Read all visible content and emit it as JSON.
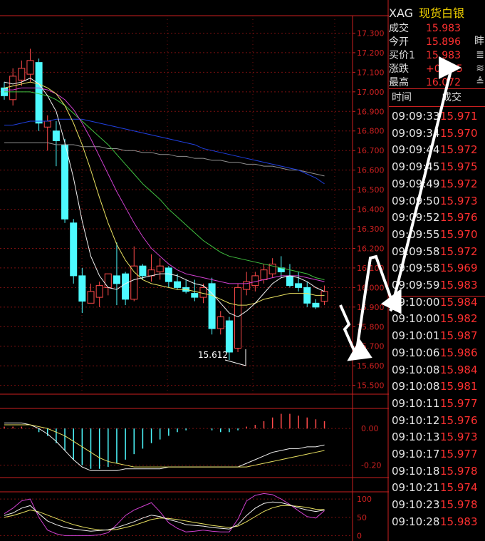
{
  "chart_data": {
    "type": "candlestick",
    "price_axis_ticks": [
      "17.300",
      "17.200",
      "17.100",
      "17.000",
      "16.900",
      "16.800",
      "16.700",
      "16.600",
      "16.500",
      "16.400",
      "16.300",
      "16.200",
      "16.100",
      "16.000",
      "15.900",
      "15.800",
      "15.700",
      "15.600",
      "15.500"
    ],
    "ylim": [
      15.455,
      17.36
    ],
    "low_annotation": "15.612",
    "candles": [
      {
        "o": 17.02,
        "h": 17.05,
        "l": 16.96,
        "c": 16.98
      },
      {
        "o": 16.96,
        "h": 17.12,
        "l": 16.93,
        "c": 17.08
      },
      {
        "o": 17.06,
        "h": 17.16,
        "l": 17.03,
        "c": 17.12
      },
      {
        "o": 17.09,
        "h": 17.22,
        "l": 17.05,
        "c": 17.16
      },
      {
        "o": 17.15,
        "h": 17.17,
        "l": 16.8,
        "c": 16.84
      },
      {
        "o": 16.82,
        "h": 16.88,
        "l": 16.7,
        "c": 16.85
      },
      {
        "o": 16.8,
        "h": 16.85,
        "l": 16.62,
        "c": 16.75
      },
      {
        "o": 16.73,
        "h": 16.76,
        "l": 16.33,
        "c": 16.35
      },
      {
        "o": 16.33,
        "h": 16.35,
        "l": 16.02,
        "c": 16.06
      },
      {
        "o": 16.06,
        "h": 16.1,
        "l": 15.87,
        "c": 15.93
      },
      {
        "o": 15.92,
        "h": 16.02,
        "l": 15.92,
        "c": 15.98
      },
      {
        "o": 15.95,
        "h": 16.03,
        "l": 15.9,
        "c": 16.01
      },
      {
        "o": 16.0,
        "h": 16.07,
        "l": 15.96,
        "c": 16.07
      },
      {
        "o": 16.06,
        "h": 16.23,
        "l": 15.91,
        "c": 16.02
      },
      {
        "o": 16.07,
        "h": 16.08,
        "l": 15.91,
        "c": 15.94
      },
      {
        "o": 15.94,
        "h": 16.21,
        "l": 15.93,
        "c": 16.11
      },
      {
        "o": 16.11,
        "h": 16.12,
        "l": 16.04,
        "c": 16.06
      },
      {
        "o": 16.06,
        "h": 16.17,
        "l": 16.03,
        "c": 16.09
      },
      {
        "o": 16.08,
        "h": 16.15,
        "l": 16.04,
        "c": 16.11
      },
      {
        "o": 16.1,
        "h": 16.11,
        "l": 16.0,
        "c": 16.03
      },
      {
        "o": 16.03,
        "h": 16.07,
        "l": 15.99,
        "c": 16.0
      },
      {
        "o": 16.0,
        "h": 16.04,
        "l": 15.97,
        "c": 15.98
      },
      {
        "o": 15.97,
        "h": 16.04,
        "l": 15.93,
        "c": 15.95
      },
      {
        "o": 15.95,
        "h": 16.02,
        "l": 15.92,
        "c": 16.0
      },
      {
        "o": 16.02,
        "h": 16.05,
        "l": 15.76,
        "c": 15.79
      },
      {
        "o": 15.79,
        "h": 15.88,
        "l": 15.76,
        "c": 15.85
      },
      {
        "o": 15.83,
        "h": 15.85,
        "l": 15.63,
        "c": 15.67
      },
      {
        "o": 15.69,
        "h": 16.02,
        "l": 15.67,
        "c": 16.0
      },
      {
        "o": 15.99,
        "h": 16.08,
        "l": 15.96,
        "c": 16.03
      },
      {
        "o": 16.01,
        "h": 16.08,
        "l": 15.98,
        "c": 16.06
      },
      {
        "o": 16.04,
        "h": 16.12,
        "l": 16.02,
        "c": 16.09
      },
      {
        "o": 16.07,
        "h": 16.15,
        "l": 16.05,
        "c": 16.12
      },
      {
        "o": 16.1,
        "h": 16.16,
        "l": 16.05,
        "c": 16.08
      },
      {
        "o": 16.06,
        "h": 16.12,
        "l": 16.0,
        "c": 16.01
      },
      {
        "o": 16.02,
        "h": 16.08,
        "l": 15.98,
        "c": 16.0
      },
      {
        "o": 16.0,
        "h": 16.03,
        "l": 15.9,
        "c": 15.92
      },
      {
        "o": 15.92,
        "h": 15.94,
        "l": 15.89,
        "c": 15.9
      },
      {
        "o": 15.93,
        "h": 16.01,
        "l": 15.91,
        "c": 15.98
      }
    ],
    "ma_white": [
      17.05,
      17.04,
      17.05,
      17.07,
      17.04,
      16.98,
      16.9,
      16.74,
      16.56,
      16.34,
      16.16,
      16.06,
      16.0,
      15.99,
      16.02,
      16.04,
      16.05,
      16.06,
      16.07,
      16.07,
      16.06,
      16.04,
      16.02,
      16.01,
      15.97,
      15.92,
      15.87,
      15.85,
      15.88,
      15.92,
      15.97,
      16.02,
      16.05,
      16.06,
      16.05,
      16.03,
      16.0,
      15.98
    ],
    "ma_yellow": [
      17.02,
      17.03,
      17.04,
      17.05,
      17.04,
      17.02,
      16.99,
      16.93,
      16.84,
      16.73,
      16.6,
      16.46,
      16.33,
      16.22,
      16.14,
      16.08,
      16.04,
      16.02,
      16.01,
      16.0,
      15.99,
      15.99,
      15.98,
      15.97,
      15.96,
      15.94,
      15.92,
      15.91,
      15.91,
      15.92,
      15.94,
      15.95,
      15.96,
      15.97,
      15.97,
      15.97,
      15.96,
      15.96
    ],
    "ma_magenta": [
      17.01,
      17.01,
      17.02,
      17.02,
      17.02,
      17.01,
      16.99,
      16.96,
      16.91,
      16.84,
      16.76,
      16.67,
      16.58,
      16.49,
      16.41,
      16.33,
      16.26,
      16.2,
      16.16,
      16.12,
      16.09,
      16.07,
      16.06,
      16.05,
      16.04,
      16.03,
      16.02,
      16.02,
      16.02,
      16.03,
      16.04,
      16.05,
      16.06,
      16.06,
      16.06,
      16.05,
      16.04,
      16.03
    ],
    "ma_green": [
      17.0,
      17.0,
      17.0,
      17.0,
      16.99,
      16.98,
      16.96,
      16.93,
      16.89,
      16.85,
      16.81,
      16.77,
      16.73,
      16.68,
      16.63,
      16.58,
      16.53,
      16.49,
      16.45,
      16.4,
      16.36,
      16.32,
      16.28,
      16.24,
      16.21,
      16.18,
      16.16,
      16.15,
      16.14,
      16.13,
      16.12,
      16.11,
      16.1,
      16.09,
      16.08,
      16.07,
      16.05,
      16.04
    ],
    "ma_blue": [
      16.83,
      16.83,
      16.84,
      16.85,
      16.85,
      16.85,
      16.86,
      16.86,
      16.86,
      16.86,
      16.85,
      16.84,
      16.83,
      16.82,
      16.81,
      16.8,
      16.79,
      16.78,
      16.77,
      16.76,
      16.75,
      16.74,
      16.73,
      16.71,
      16.7,
      16.69,
      16.68,
      16.67,
      16.66,
      16.65,
      16.64,
      16.63,
      16.62,
      16.61,
      16.6,
      16.58,
      16.56,
      16.53
    ],
    "ma_gray": [
      16.74,
      16.74,
      16.74,
      16.74,
      16.74,
      16.74,
      16.73,
      16.73,
      16.73,
      16.72,
      16.72,
      16.72,
      16.71,
      16.71,
      16.7,
      16.7,
      16.69,
      16.69,
      16.68,
      16.68,
      16.67,
      16.67,
      16.66,
      16.66,
      16.65,
      16.65,
      16.64,
      16.64,
      16.63,
      16.63,
      16.62,
      16.62,
      16.61,
      16.6,
      16.6,
      16.59,
      16.58,
      16.57
    ],
    "macd_axis_ticks": [
      "0.00",
      "-0.20"
    ],
    "macd_ylim": [
      -0.26,
      0.09
    ],
    "macd_hist": [
      0.01,
      0.01,
      0.01,
      0.0,
      -0.02,
      -0.04,
      -0.08,
      -0.12,
      -0.17,
      -0.2,
      -0.22,
      -0.22,
      -0.21,
      -0.19,
      -0.17,
      -0.14,
      -0.11,
      -0.08,
      -0.06,
      -0.04,
      -0.02,
      -0.01,
      0.0,
      0.0,
      -0.01,
      -0.02,
      -0.02,
      -0.01,
      0.01,
      0.02,
      0.04,
      0.06,
      0.08,
      0.08,
      0.07,
      0.06,
      0.05,
      0.04
    ],
    "macd_dif": [
      0.03,
      0.03,
      0.03,
      0.02,
      0.0,
      -0.03,
      -0.07,
      -0.12,
      -0.17,
      -0.21,
      -0.23,
      -0.23,
      -0.23,
      -0.23,
      -0.22,
      -0.22,
      -0.22,
      -0.22,
      -0.22,
      -0.21,
      -0.21,
      -0.21,
      -0.21,
      -0.21,
      -0.21,
      -0.21,
      -0.21,
      -0.21,
      -0.19,
      -0.17,
      -0.15,
      -0.13,
      -0.12,
      -0.11,
      -0.11,
      -0.1,
      -0.1,
      -0.09
    ],
    "macd_dea": [
      0.02,
      0.02,
      0.02,
      0.02,
      0.01,
      0.0,
      -0.02,
      -0.04,
      -0.07,
      -0.1,
      -0.13,
      -0.16,
      -0.18,
      -0.19,
      -0.2,
      -0.21,
      -0.21,
      -0.21,
      -0.21,
      -0.21,
      -0.21,
      -0.21,
      -0.21,
      -0.21,
      -0.21,
      -0.21,
      -0.21,
      -0.21,
      -0.21,
      -0.2,
      -0.19,
      -0.18,
      -0.17,
      -0.16,
      -0.15,
      -0.14,
      -0.13,
      -0.12
    ],
    "kdj_axis_ticks": [
      "100",
      "50",
      "0"
    ],
    "kdj_ylim": [
      -5,
      110
    ],
    "kdj_k": [
      55,
      62,
      75,
      82,
      60,
      40,
      30,
      22,
      18,
      15,
      12,
      14,
      16,
      22,
      30,
      38,
      48,
      56,
      52,
      44,
      38,
      30,
      28,
      26,
      22,
      20,
      18,
      30,
      55,
      75,
      88,
      92,
      90,
      84,
      76,
      70,
      66,
      70
    ],
    "kdj_d": [
      50,
      55,
      62,
      70,
      65,
      56,
      47,
      38,
      30,
      24,
      19,
      16,
      15,
      17,
      22,
      28,
      36,
      44,
      48,
      47,
      44,
      40,
      36,
      32,
      28,
      25,
      22,
      26,
      38,
      52,
      66,
      76,
      82,
      82,
      80,
      77,
      72,
      71
    ],
    "kdj_j": [
      60,
      75,
      95,
      100,
      50,
      15,
      5,
      0,
      0,
      0,
      0,
      2,
      8,
      30,
      55,
      70,
      80,
      90,
      65,
      35,
      20,
      10,
      12,
      15,
      12,
      10,
      10,
      45,
      95,
      110,
      115,
      112,
      100,
      85,
      68,
      52,
      48,
      68
    ]
  },
  "quote": {
    "symbol": "XAG",
    "name": "现货白银",
    "rows": [
      {
        "label": "成交",
        "value": "15.983"
      },
      {
        "label": "今开",
        "value": "15.896",
        "extra": "盽"
      },
      {
        "label": "买价1",
        "value": "15.983",
        "extra": "≣"
      },
      {
        "label": "涨跌",
        "value": "+0.095",
        "extra": "≋"
      },
      {
        "label": "最高",
        "value": "16.072",
        "extra": "≜"
      }
    ]
  },
  "ticks": {
    "header_time": "时间",
    "header_price": "成交",
    "rows": [
      {
        "time": "09:09:33",
        "price": "15.971"
      },
      {
        "time": "09:09:34",
        "price": "15.970"
      },
      {
        "time": "09:09:44",
        "price": "15.972"
      },
      {
        "time": "09:09:45",
        "price": "15.975"
      },
      {
        "time": "09:09:49",
        "price": "15.972"
      },
      {
        "time": "09:09:50",
        "price": "15.973"
      },
      {
        "time": "09:09:52",
        "price": "15.976"
      },
      {
        "time": "09:09:55",
        "price": "15.970"
      },
      {
        "time": "09:09:58",
        "price": "15.972"
      },
      {
        "time": "09:09:58",
        "price": "15.969"
      },
      {
        "time": "09:09:59",
        "price": "15.983"
      },
      {
        "time": "09:10:00",
        "price": "15.984"
      },
      {
        "time": "09:10:00",
        "price": "15.982"
      },
      {
        "time": "09:10:01",
        "price": "15.987"
      },
      {
        "time": "09:10:06",
        "price": "15.986"
      },
      {
        "time": "09:10:08",
        "price": "15.984"
      },
      {
        "time": "09:10:08",
        "price": "15.981"
      },
      {
        "time": "09:10:11",
        "price": "15.977"
      },
      {
        "time": "09:10:12",
        "price": "15.976"
      },
      {
        "time": "09:10:13",
        "price": "15.973"
      },
      {
        "time": "09:10:17",
        "price": "15.977"
      },
      {
        "time": "09:10:18",
        "price": "15.978"
      },
      {
        "time": "09:10:21",
        "price": "15.974"
      },
      {
        "time": "09:10:23",
        "price": "15.978"
      },
      {
        "time": "09:10:28",
        "price": "15.983"
      }
    ]
  },
  "colors": {
    "up": "#ff4a4a",
    "down": "#4dfaff",
    "axis": "#cc2020",
    "grid": "#7a1010",
    "ma_white": "#f0f0f0",
    "ma_yellow": "#e8e060",
    "ma_magenta": "#d040d0",
    "ma_green": "#40c040",
    "ma_blue": "#2040e0",
    "ma_gray": "#909090",
    "arrow": "#ffffff"
  }
}
